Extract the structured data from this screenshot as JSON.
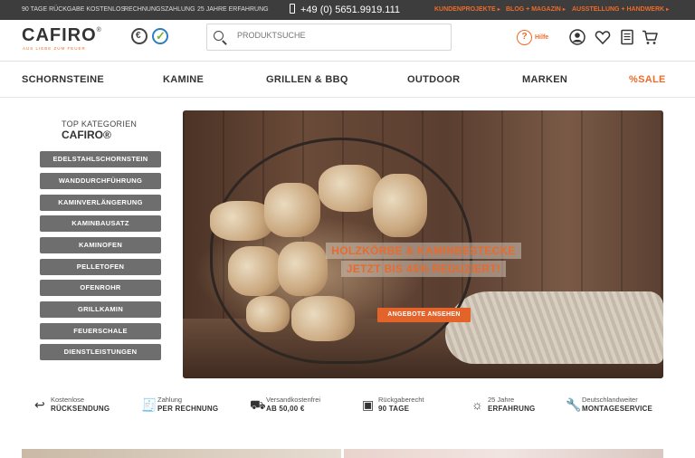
{
  "topbar": {
    "usp": [
      "90 TAGE RÜCKGABE KOSTENLOS",
      "RECHNUNGSZAHLUNG",
      "25 JAHRE ERFAHRUNG"
    ],
    "phone": "+49 (0) 5651.9919.111",
    "links": [
      "KUNDENPROJEKTE",
      "BLOG + MAGAZIN",
      "AUSSTELLUNG + HANDWERK"
    ]
  },
  "header": {
    "logo": "CAFIRO",
    "logo_mark": "®",
    "tagline": "AUS LIEBE ZUM FEUER",
    "search_placeholder": "PRODUKTSUCHE",
    "help_label": "Hilfe",
    "icons": [
      "account-icon",
      "wishlist-icon",
      "notepad-icon",
      "cart-icon"
    ]
  },
  "nav": [
    "SCHORNSTEINE",
    "KAMINE",
    "GRILLEN & BBQ",
    "OUTDOOR",
    "MARKEN",
    "%SALE"
  ],
  "sidebar": {
    "title": "TOP KATEGORIEN",
    "subtitle": "CAFIRO®",
    "items": [
      "EDELSTAHLSCHORNSTEIN",
      "WANDDURCHFÜHRUNG",
      "KAMINVERLÄNGERUNG",
      "KAMINBAUSATZ",
      "KAMINOFEN",
      "PELLETOFEN",
      "OFENROHR",
      "GRILLKAMIN",
      "FEUERSCHALE",
      "DIENSTLEISTUNGEN"
    ]
  },
  "hero": {
    "line1": "HOLZKÖRBE & KAMINBESTECKE",
    "line2": "JETZT BIS 45% REDUZIERT!",
    "cta": "ANGEBOTE ANSEHEN"
  },
  "usps": [
    {
      "l1": "Kostenlose",
      "l2": "RÜCKSENDUNG",
      "icon": "return-icon"
    },
    {
      "l1": "Zahlung",
      "l2": "PER RECHNUNG",
      "icon": "invoice-icon"
    },
    {
      "l1": "Versandkostenfrei",
      "l2": "AB 50,00 €",
      "icon": "shipping-icon"
    },
    {
      "l1": "Rückgaberecht",
      "l2": "90 TAGE",
      "icon": "box-icon"
    },
    {
      "l1": "25 Jahre",
      "l2": "ERFAHRUNG",
      "icon": "bulb-icon"
    },
    {
      "l1": "Deutschlandweiter",
      "l2": "MONTAGESERVICE",
      "icon": "wrench-icon"
    }
  ],
  "colors": {
    "accent": "#ee6b2a",
    "topbar": "#3d3d3d",
    "category": "#6e6e6e"
  }
}
